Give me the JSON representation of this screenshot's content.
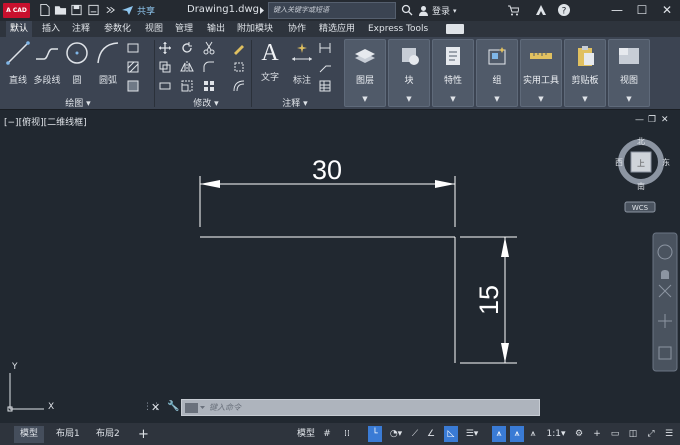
{
  "app": {
    "logo_text": "A CAD",
    "document_title": "Drawing1.dwg",
    "share_label": "共享",
    "search_placeholder": "键入关键字或短语",
    "login_label": "登录"
  },
  "ribbon_tabs": [
    "默认",
    "插入",
    "注释",
    "参数化",
    "视图",
    "管理",
    "输出",
    "附加模块",
    "协作",
    "精选应用",
    "Express Tools"
  ],
  "ribbon": {
    "draw": {
      "line": "直线",
      "polyline": "多段线",
      "circle": "圆",
      "arc": "圆弧",
      "panel_title": "绘图"
    },
    "modify": {
      "panel_title": "修改"
    },
    "annotation": {
      "text": "文字",
      "dimension": "标注",
      "panel_title": "注释"
    },
    "layers": "图层",
    "block": "块",
    "properties": "特性",
    "groups": "组",
    "utilities": "实用工具",
    "clipboard": "剪贴板",
    "view": "视图"
  },
  "viewport": {
    "label": "[−][俯视][二维线框]",
    "viewcube": {
      "north": "北",
      "south": "南",
      "east": "东",
      "west": "西",
      "top": "上",
      "wcs": "WCS"
    }
  },
  "drawing": {
    "horizontal_dim": "30",
    "vertical_dim": "15",
    "ucs_x": "X",
    "ucs_y": "Y"
  },
  "command_line": {
    "placeholder": "键入命令"
  },
  "status_bar": {
    "layout_tabs": [
      "模型",
      "布局1",
      "布局2"
    ],
    "add_tab": "+",
    "model_button": "模型",
    "scale": "1:1"
  },
  "colors": {
    "background": "#212830",
    "ribbon": "#3c4452",
    "accent": "#3a7bd5",
    "logo": "#c8102e"
  }
}
